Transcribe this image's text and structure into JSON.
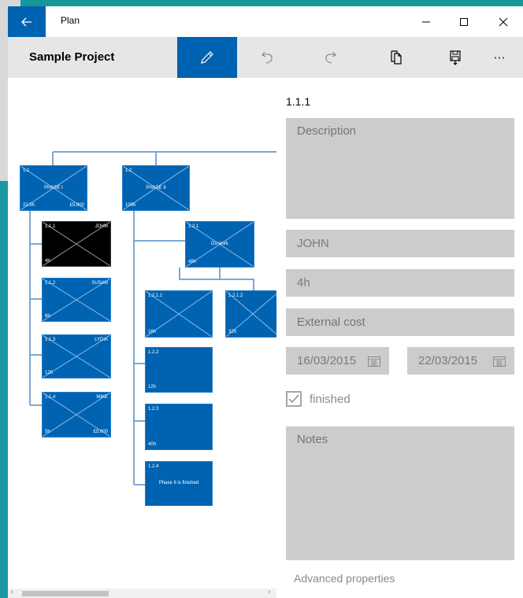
{
  "window": {
    "title": "Plan",
    "back_icon": "arrow-left-icon",
    "minimize_glyph": "—",
    "maximize_glyph": "☐",
    "close_glyph": "✕"
  },
  "toolbar": {
    "project_title": "Sample Project",
    "more_label": "···",
    "accent": "#0063b1"
  },
  "diagram": {
    "nodes": [
      {
        "id": "1.1",
        "name": "PHASE I",
        "resource": "",
        "hours": "22.5h",
        "cost": "£5,000"
      },
      {
        "id": "1.2",
        "name": "PHASE II",
        "resource": "",
        "hours": "100h",
        "cost": ""
      },
      {
        "id": "1.1.1",
        "name": "",
        "resource": "JOHN",
        "hours": "4h",
        "cost": "",
        "selected": true
      },
      {
        "id": "1.1.2",
        "name": "",
        "resource": "SUSAN",
        "hours": "6h",
        "cost": ""
      },
      {
        "id": "1.1.3",
        "name": "",
        "resource": "LYDIA",
        "hours": "12h",
        "cost": ""
      },
      {
        "id": "1.1.4",
        "name": "",
        "resource": "MIKE",
        "hours": "5h",
        "cost": "£5,000"
      },
      {
        "id": "1.2.1",
        "name": "Do work",
        "resource": "",
        "hours": "48h",
        "cost": ""
      },
      {
        "id": "1.2.1.1",
        "name": "",
        "resource": "",
        "hours": "16h",
        "cost": ""
      },
      {
        "id": "1.2.1.2",
        "name": "",
        "resource": "",
        "hours": "32h",
        "cost": ""
      },
      {
        "id": "1.2.2",
        "name": "",
        "resource": "",
        "hours": "12h",
        "cost": ""
      },
      {
        "id": "1.2.3",
        "name": "",
        "resource": "",
        "hours": "40h",
        "cost": ""
      },
      {
        "id": "1.2.4",
        "name": "Phase II is finished",
        "resource": "",
        "hours": "",
        "cost": ""
      }
    ]
  },
  "properties": {
    "id": "1.1.1",
    "description_placeholder": "Description",
    "resource_value": "JOHN",
    "hours_value": "4h",
    "external_cost_placeholder": "External cost",
    "start_date": "16/03/2015",
    "end_date": "22/03/2015",
    "finished_label": "finished",
    "finished_checked": true,
    "notes_placeholder": "Notes",
    "advanced_label": "Advanced properties"
  }
}
